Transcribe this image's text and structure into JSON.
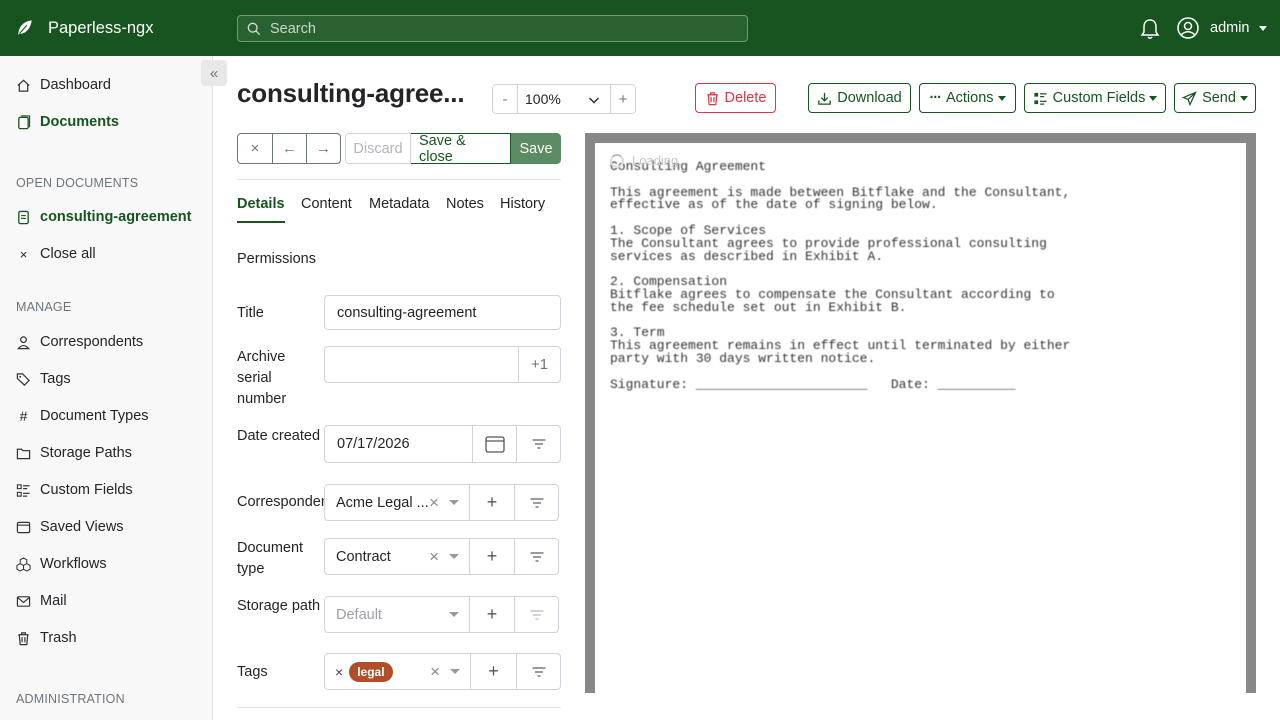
{
  "app": {
    "name": "Paperless-ngx"
  },
  "search": {
    "placeholder": "Search"
  },
  "user": {
    "name": "admin"
  },
  "sidebar": {
    "dashboard": "Dashboard",
    "documents": "Documents",
    "open_documents_heading": "OPEN DOCUMENTS",
    "open_doc": "consulting-agreement",
    "close_all": "Close all",
    "manage_heading": "MANAGE",
    "manage_items": [
      "Correspondents",
      "Tags",
      "Document Types",
      "Storage Paths",
      "Custom Fields",
      "Saved Views",
      "Workflows",
      "Mail",
      "Trash"
    ],
    "administration_heading": "ADMINISTRATION"
  },
  "header": {
    "title": "consulting-agree...",
    "zoom_minus": "-",
    "zoom_value": "100%",
    "zoom_plus": "+",
    "delete": "Delete",
    "download": "Download",
    "actions": "Actions",
    "custom_fields": "Custom Fields",
    "send": "Send"
  },
  "toolbar": {
    "close": "×",
    "prev": "←",
    "next": "→",
    "discard": "Discard",
    "save_close": "Save & close",
    "save": "Save"
  },
  "tabs": [
    "Details",
    "Content",
    "Metadata",
    "Notes",
    "History"
  ],
  "form": {
    "permissions": "Permissions",
    "title_label": "Title",
    "title_value": "consulting-agreement",
    "asn_label": "Archive serial number",
    "asn_value": "",
    "asn_plus": "+1",
    "date_label": "Date created",
    "date_value": "07/17/2026",
    "correspondent_label": "Correspondent",
    "correspondent_value": "Acme Legal ...",
    "doctype_label": "Document type",
    "doctype_value": "Contract",
    "storage_label": "Storage path",
    "storage_value": "Default",
    "tags_label": "Tags",
    "tags_value": "legal"
  },
  "preview": {
    "loading": "Loading...",
    "text": "Consulting Agreement\n\nThis agreement is made between Bitflake and the Consultant,\neffective as of the date of signing below.\n\n1. Scope of Services\nThe Consultant agrees to provide professional consulting\nservices as described in Exhibit A.\n\n2. Compensation\nBitflake agrees to compensate the Consultant according to\nthe fee schedule set out in Exhibit B.\n\n3. Term\nThis agreement remains in effect until terminated by either\nparty with 30 days written notice.\n\nSignature: ______________________   Date: __________"
  },
  "colors": {
    "brand": "#17541f",
    "danger": "#dc3545",
    "tag": "#b04e29"
  }
}
